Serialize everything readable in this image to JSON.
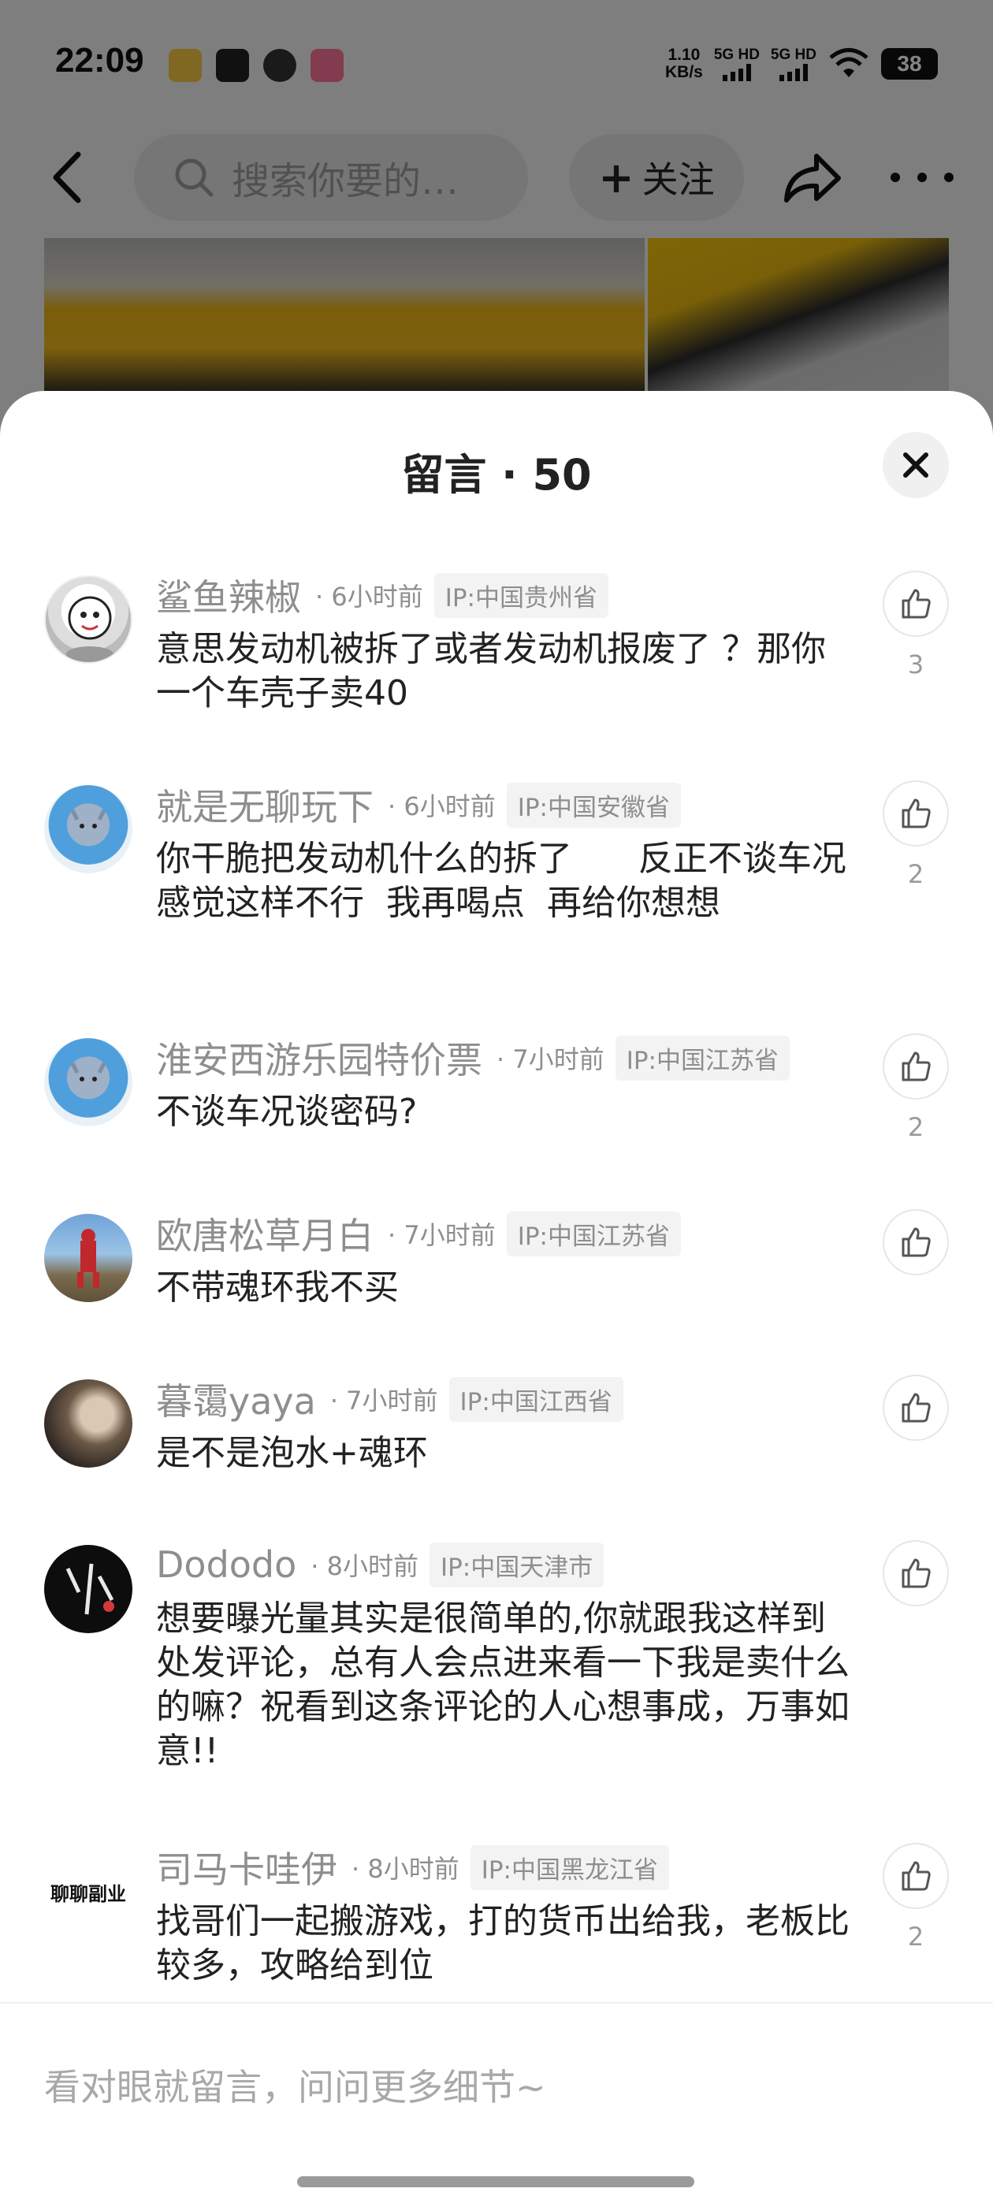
{
  "status_bar": {
    "time": "22:09",
    "net_speed_value": "1.10",
    "net_speed_unit": "KB/s",
    "sim1": "5G HD",
    "sim2": "5G HD",
    "battery": "38",
    "app_icons": [
      "weibo-icon",
      "tape-icon",
      "cat-icon",
      "bilibili-icon"
    ]
  },
  "nav": {
    "search_placeholder": "搜索你要的…",
    "follow_label": "关注"
  },
  "sheet": {
    "title": "留言 · 50"
  },
  "comments": [
    {
      "username": "鲨鱼辣椒",
      "time": "· 6小时前",
      "ip": "IP:中国贵州省",
      "text": "意思发动机被拆了或者发动机报废了 ？那你一个车壳子卖40",
      "likes": "3"
    },
    {
      "username": "就是无聊玩下",
      "time": "· 6小时前",
      "ip": "IP:中国安徽省",
      "text": "你干脆把发动机什么的拆了      反正不谈车况  感觉这样不行  我再喝点  再给你想想",
      "likes": "2"
    },
    {
      "username": "淮安西游乐园特价票",
      "time": "· 7小时前",
      "ip": "IP:中国江苏省",
      "text": "不谈车况谈密码?",
      "likes": "2"
    },
    {
      "username": "欧唐松草月白",
      "time": "· 7小时前",
      "ip": "IP:中国江苏省",
      "text": "不带魂环我不买",
      "likes": ""
    },
    {
      "username": "暮霭yaya",
      "time": "· 7小时前",
      "ip": "IP:中国江西省",
      "text": "是不是泡水+魂环",
      "likes": ""
    },
    {
      "username": "Dododo",
      "time": "· 8小时前",
      "ip": "IP:中国天津市",
      "text": "想要曝光量其实是很简单的,你就跟我这样到处发评论，总有人会点进来看一下我是卖什么的嘛？祝看到这条评论的人心想事成，万事如意!!",
      "likes": ""
    },
    {
      "username": "司马卡哇伊",
      "time": "· 8小时前",
      "ip": "IP:中国黑龙江省",
      "text": "找哥们一起搬游戏，打的货币出给我，老板比较多，攻略给到位",
      "likes": "2",
      "avatar_text": "聊聊副业"
    }
  ],
  "input": {
    "placeholder": "看对眼就留言，问问更多细节~"
  }
}
